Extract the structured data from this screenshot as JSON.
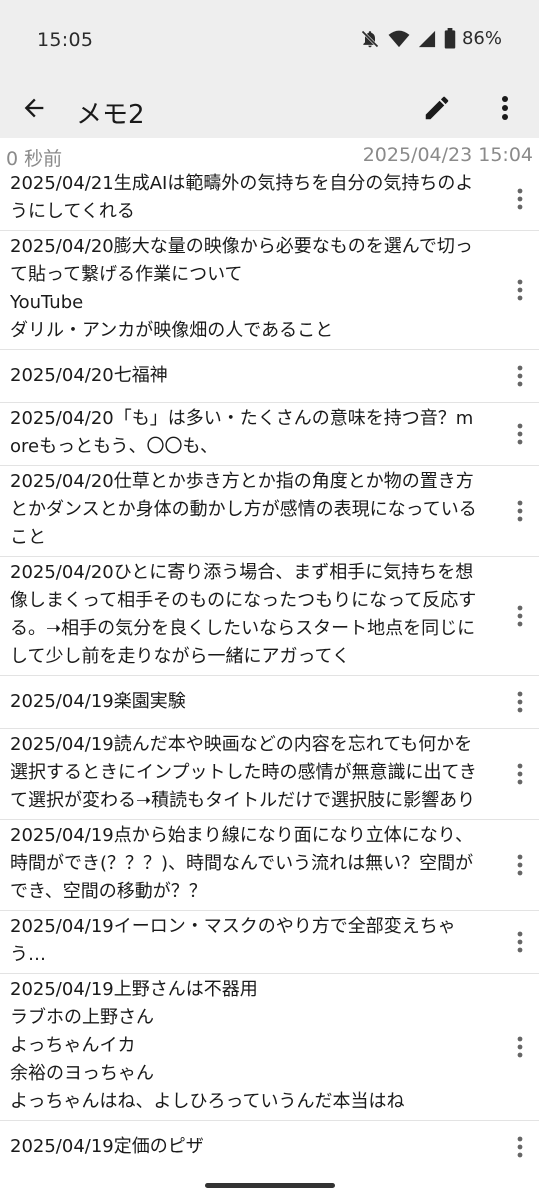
{
  "status": {
    "time": "15:05",
    "battery": "86%",
    "icons": [
      "mute-icon",
      "wifi-icon",
      "signal-icon",
      "battery-icon"
    ]
  },
  "appbar": {
    "title": "メモ2",
    "icons": [
      "back-arrow-icon",
      "pencil-icon",
      "more-vert-icon"
    ]
  },
  "meta": {
    "left": "0 秒前",
    "right": "2025/04/23 15:04"
  },
  "memos": [
    "2025/04/21生成AIは範疇外の気持ちを自分の気持ちのようにしてくれる",
    "2025/04/20膨大な量の映像から必要なものを選んで切って貼って繋げる作業について\nYouTube\nダリル・アンカが映像畑の人であること",
    "2025/04/20七福神",
    "2025/04/20「も」は多い・たくさんの意味を持つ音？moreもっともう、〇〇も、",
    "2025/04/20仕草とか歩き方とか指の角度とか物の置き方とかダンスとか身体の動かし方が感情の表現になっていること",
    "2025/04/20ひとに寄り添う場合、まず相手に気持ちを想像しまくって相手そのものになったつもりになって反応する。➝相手の気分を良くしたいならスタート地点を同じにして少し前を走りながら一緒にアガってく",
    "2025/04/19楽園実験",
    "2025/04/19読んだ本や映画などの内容を忘れても何かを選択するときにインプットした時の感情が無意識に出てきて選択が変わる➝積読もタイトルだけで選択肢に影響あり",
    "2025/04/19点から始まり線になり面になり立体になり、時間ができ(？？？)、時間なんでいう流れは無い？空間ができ、空間の移動が？？",
    "2025/04/19イーロン・マスクのやり方で全部変えちゃう…",
    "2025/04/19上野さんは不器用\nラブホの上野さん\nよっちゃんイカ\n余裕のヨっちゃん\nよっちゃんはね、よしひろっていうんだ本当はね",
    "2025/04/19定価のピザ"
  ],
  "colors": {
    "background": "#eeeeee",
    "surface": "#ffffff",
    "text": "#1a1a1a",
    "secondary_text": "#8a8a8a",
    "divider": "#e3e3e3"
  }
}
